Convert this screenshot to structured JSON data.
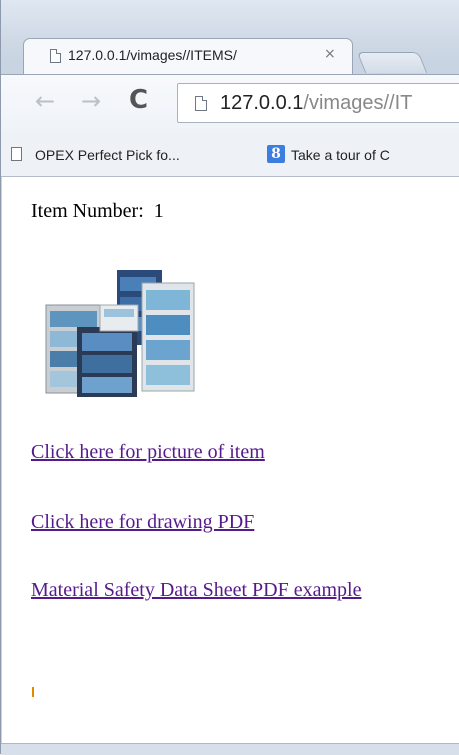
{
  "browser": {
    "tab": {
      "title": "127.0.0.1/vimages//ITEMS/",
      "close": "×"
    },
    "address": {
      "host": "127.0.0.1",
      "path": "/vimages//IT"
    },
    "bookmarks": [
      {
        "label": "OPEX Perfect Pick fo..."
      },
      {
        "label": "Take a tour of C",
        "icon_text": "8"
      }
    ]
  },
  "page": {
    "item_label": "Item Number:",
    "item_number": "1",
    "links": [
      "Click here for picture of item",
      "Click here for drawing PDF",
      "Material Safety Data Sheet PDF example"
    ]
  },
  "colors": {
    "link_visited": "#551a8b",
    "accent": "#3d7de0"
  }
}
